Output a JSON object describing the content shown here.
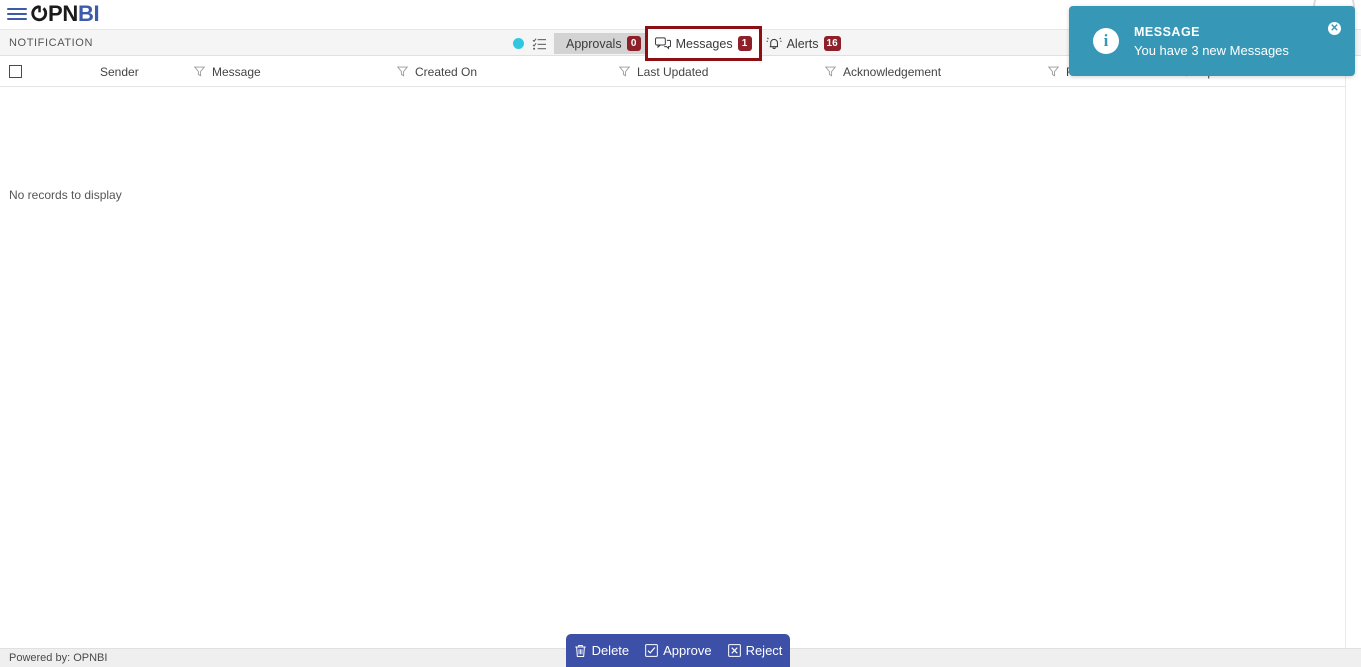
{
  "app": {
    "logo_power": "power-icon",
    "logo_text_dark": "PN",
    "logo_text_blue": "BI",
    "menu_icon": "hamburger-menu-icon"
  },
  "notification_bar": {
    "title": "NOTIFICATION",
    "status_dot_color": "#33c6e0",
    "list_icon": "checklist-icon",
    "tabs": [
      {
        "label": "Approvals",
        "badge": "0",
        "icon": "approvals-icon",
        "state": "active"
      },
      {
        "label": "Messages",
        "badge": "1",
        "icon": "messages-icon",
        "state": "highlighted"
      },
      {
        "label": "Alerts",
        "badge": "16",
        "icon": "bell-icon",
        "state": "normal"
      }
    ],
    "badge_color": "#8d2029",
    "highlight_color": "#8d0f13"
  },
  "table": {
    "select_all": "select-all-checkbox",
    "columns": [
      {
        "label": "Sender",
        "filter": true
      },
      {
        "label": "Message",
        "filter": true
      },
      {
        "label": "Created On",
        "filter": true
      },
      {
        "label": "Last Updated",
        "filter": true
      },
      {
        "label": "Acknowledgement",
        "filter": true
      },
      {
        "label": "Read Status",
        "filter": true
      },
      {
        "label": "Options",
        "filter": true
      }
    ],
    "empty_text": "No records to display",
    "rows": []
  },
  "action_bar": {
    "background": "#3c50a8",
    "buttons": [
      {
        "label": "Delete",
        "icon": "trash-icon"
      },
      {
        "label": "Approve",
        "icon": "check-box-icon"
      },
      {
        "label": "Reject",
        "icon": "x-box-icon"
      }
    ]
  },
  "footer": {
    "text": "Powered by: OPNBI"
  },
  "toast": {
    "title": "MESSAGE",
    "body": "You have 3 new Messages",
    "icon": "info-icon",
    "close_icon": "close-icon",
    "close_glyph": "✕",
    "background": "#3698b6"
  }
}
